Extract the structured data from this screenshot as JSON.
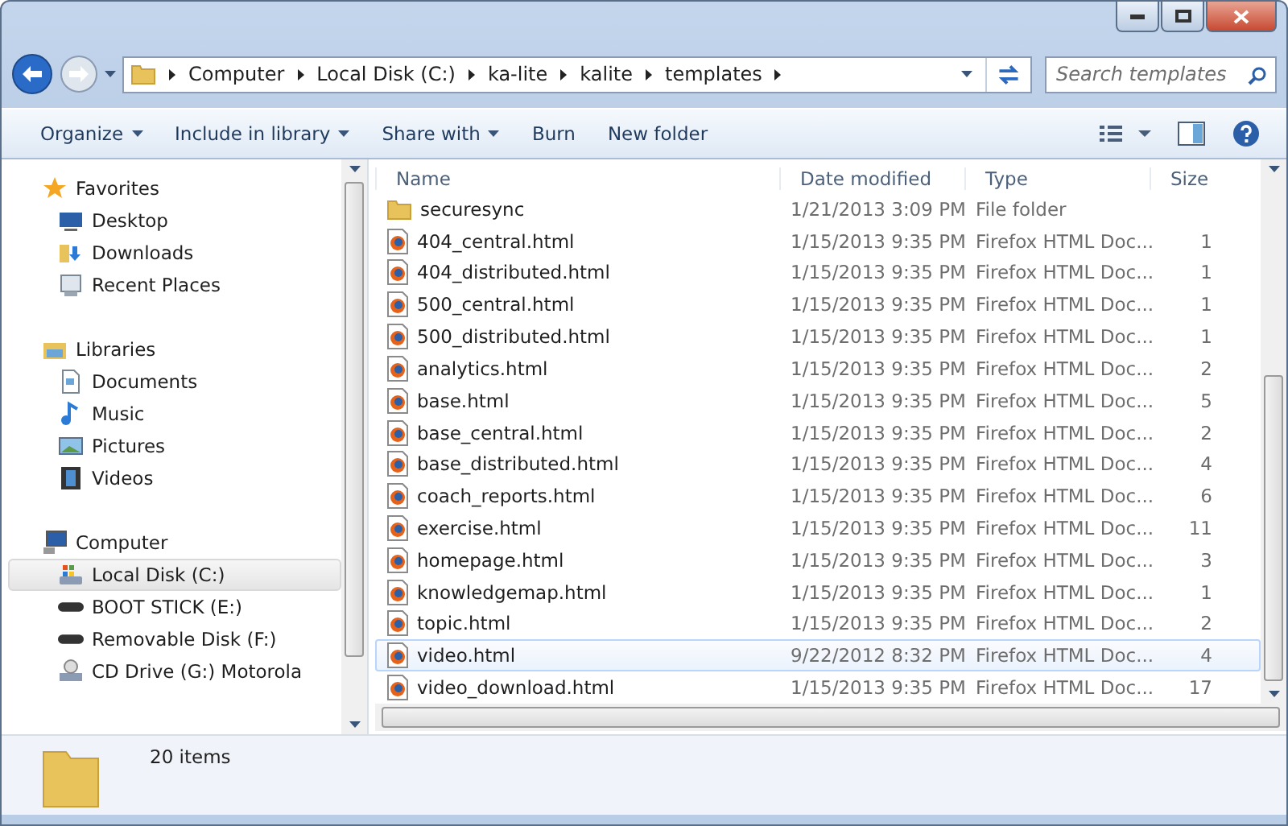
{
  "address": {
    "crumbs": [
      "Computer",
      "Local Disk (C:)",
      "ka-lite",
      "kalite",
      "templates"
    ]
  },
  "search": {
    "placeholder": "Search templates"
  },
  "toolbar": [
    {
      "label": "Organize",
      "dropdown": true
    },
    {
      "label": "Include in library",
      "dropdown": true
    },
    {
      "label": "Share with",
      "dropdown": true
    },
    {
      "label": "Burn",
      "dropdown": false
    },
    {
      "label": "New folder",
      "dropdown": false
    }
  ],
  "sidebar": [
    {
      "label": "Favorites",
      "kind": "star",
      "children": [
        {
          "label": "Desktop",
          "kind": "desktop",
          "selected": false
        },
        {
          "label": "Downloads",
          "kind": "downloads",
          "selected": false
        },
        {
          "label": "Recent Places",
          "kind": "recent",
          "selected": false
        }
      ]
    },
    {
      "label": "Libraries",
      "kind": "library",
      "children": [
        {
          "label": "Documents",
          "kind": "document",
          "selected": false
        },
        {
          "label": "Music",
          "kind": "music",
          "selected": false
        },
        {
          "label": "Pictures",
          "kind": "pictures",
          "selected": false
        },
        {
          "label": "Videos",
          "kind": "videos",
          "selected": false
        }
      ]
    },
    {
      "label": "Computer",
      "kind": "computer",
      "children": [
        {
          "label": "Local Disk (C:)",
          "kind": "disk",
          "selected": true
        },
        {
          "label": "BOOT STICK (E:)",
          "kind": "drive",
          "selected": false
        },
        {
          "label": "Removable Disk (F:)",
          "kind": "drive",
          "selected": false
        },
        {
          "label": "CD Drive (G:) Motorola",
          "kind": "cd",
          "selected": false
        }
      ]
    }
  ],
  "table": {
    "columns": [
      "Name",
      "Date modified",
      "Type",
      "Size"
    ],
    "rows": [
      {
        "kind": "folder",
        "name": "securesync",
        "date": "1/21/2013 3:09 PM",
        "type": "File folder",
        "hovered": false
      },
      {
        "kind": "html",
        "name": "404_central.html",
        "date": "1/15/2013 9:35 PM",
        "type": "Firefox HTML Doc...",
        "size": "1",
        "hovered": false
      },
      {
        "kind": "html",
        "name": "404_distributed.html",
        "date": "1/15/2013 9:35 PM",
        "type": "Firefox HTML Doc...",
        "size": "1",
        "hovered": false
      },
      {
        "kind": "html",
        "name": "500_central.html",
        "date": "1/15/2013 9:35 PM",
        "type": "Firefox HTML Doc...",
        "size": "1",
        "hovered": false
      },
      {
        "kind": "html",
        "name": "500_distributed.html",
        "date": "1/15/2013 9:35 PM",
        "type": "Firefox HTML Doc...",
        "size": "1",
        "hovered": false
      },
      {
        "kind": "html",
        "name": "analytics.html",
        "date": "1/15/2013 9:35 PM",
        "type": "Firefox HTML Doc...",
        "size": "2",
        "hovered": false
      },
      {
        "kind": "html",
        "name": "base.html",
        "date": "1/15/2013 9:35 PM",
        "type": "Firefox HTML Doc...",
        "size": "5",
        "hovered": false
      },
      {
        "kind": "html",
        "name": "base_central.html",
        "date": "1/15/2013 9:35 PM",
        "type": "Firefox HTML Doc...",
        "size": "2",
        "hovered": false
      },
      {
        "kind": "html",
        "name": "base_distributed.html",
        "date": "1/15/2013 9:35 PM",
        "type": "Firefox HTML Doc...",
        "size": "4",
        "hovered": false
      },
      {
        "kind": "html",
        "name": "coach_reports.html",
        "date": "1/15/2013 9:35 PM",
        "type": "Firefox HTML Doc...",
        "size": "6",
        "hovered": false
      },
      {
        "kind": "html",
        "name": "exercise.html",
        "date": "1/15/2013 9:35 PM",
        "type": "Firefox HTML Doc...",
        "size": "11",
        "hovered": false
      },
      {
        "kind": "html",
        "name": "homepage.html",
        "date": "1/15/2013 9:35 PM",
        "type": "Firefox HTML Doc...",
        "size": "3",
        "hovered": false
      },
      {
        "kind": "html",
        "name": "knowledgemap.html",
        "date": "1/15/2013 9:35 PM",
        "type": "Firefox HTML Doc...",
        "size": "1",
        "hovered": false
      },
      {
        "kind": "html",
        "name": "topic.html",
        "date": "1/15/2013 9:35 PM",
        "type": "Firefox HTML Doc...",
        "size": "2",
        "hovered": false
      },
      {
        "kind": "html",
        "name": "video.html",
        "date": "9/22/2012 8:32 PM",
        "type": "Firefox HTML Doc...",
        "size": "4",
        "hovered": true
      },
      {
        "kind": "html",
        "name": "video_download.html",
        "date": "1/15/2013 9:35 PM",
        "type": "Firefox HTML Doc...",
        "size": "17",
        "hovered": false
      }
    ]
  },
  "status_bar": {
    "count": "20 items"
  }
}
